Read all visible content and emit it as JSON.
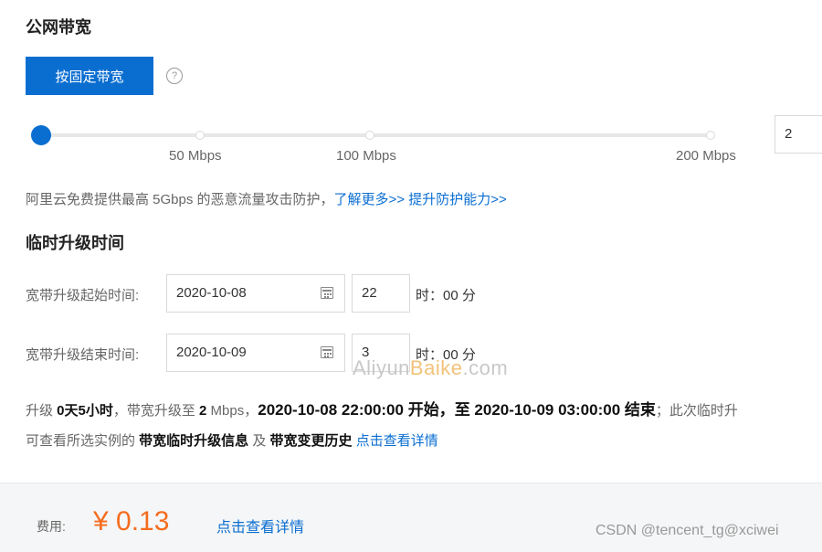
{
  "bandwidth": {
    "title": "公网带宽",
    "fixed_button": "按固定带宽",
    "help_icon": "?",
    "slider": {
      "ticks": [
        "50 Mbps",
        "100 Mbps",
        "200 Mbps"
      ],
      "value": 2
    },
    "input_value": "2",
    "note_prefix": "阿里云免费提供最高 5Gbps 的恶意流量攻击防护，",
    "note_link1": "了解更多>>",
    "note_link2": "提升防护能力>>"
  },
  "upgrade": {
    "title": "临时升级时间",
    "start_label": "宽带升级起始时间:",
    "start_date": "2020-10-08",
    "start_hour": "22",
    "end_label": "宽带升级结束时间:",
    "end_date": "2020-10-09",
    "end_hour": "3",
    "hour_unit": "时：",
    "minute": "00 分"
  },
  "watermark": {
    "prefix": "Aliyun",
    "highlight": "Baike",
    "suffix": ".com"
  },
  "summary": {
    "p1": "升级 ",
    "duration": "0天5小时",
    "p2": "，带宽升级至 ",
    "value": "2",
    "unit": " Mbps，",
    "start_text": "2020-10-08 22:00:00 开始，至 2020-10-09 03:00:00 结束",
    "tail": "；此次临时升",
    "line2_p1": "可查看所选实例的 ",
    "info": "带宽临时升级信息",
    "and": " 及 ",
    "history": "带宽变更历史",
    "details_link": "点击查看详情"
  },
  "footer": {
    "fee_label": "费用:",
    "fee_value": "¥ 0.13",
    "details_link": "点击查看详情",
    "credit": "CSDN @tencent_tg@xciwei"
  },
  "colors": {
    "accent": "#0a6ed1",
    "price": "#f56c1d"
  }
}
